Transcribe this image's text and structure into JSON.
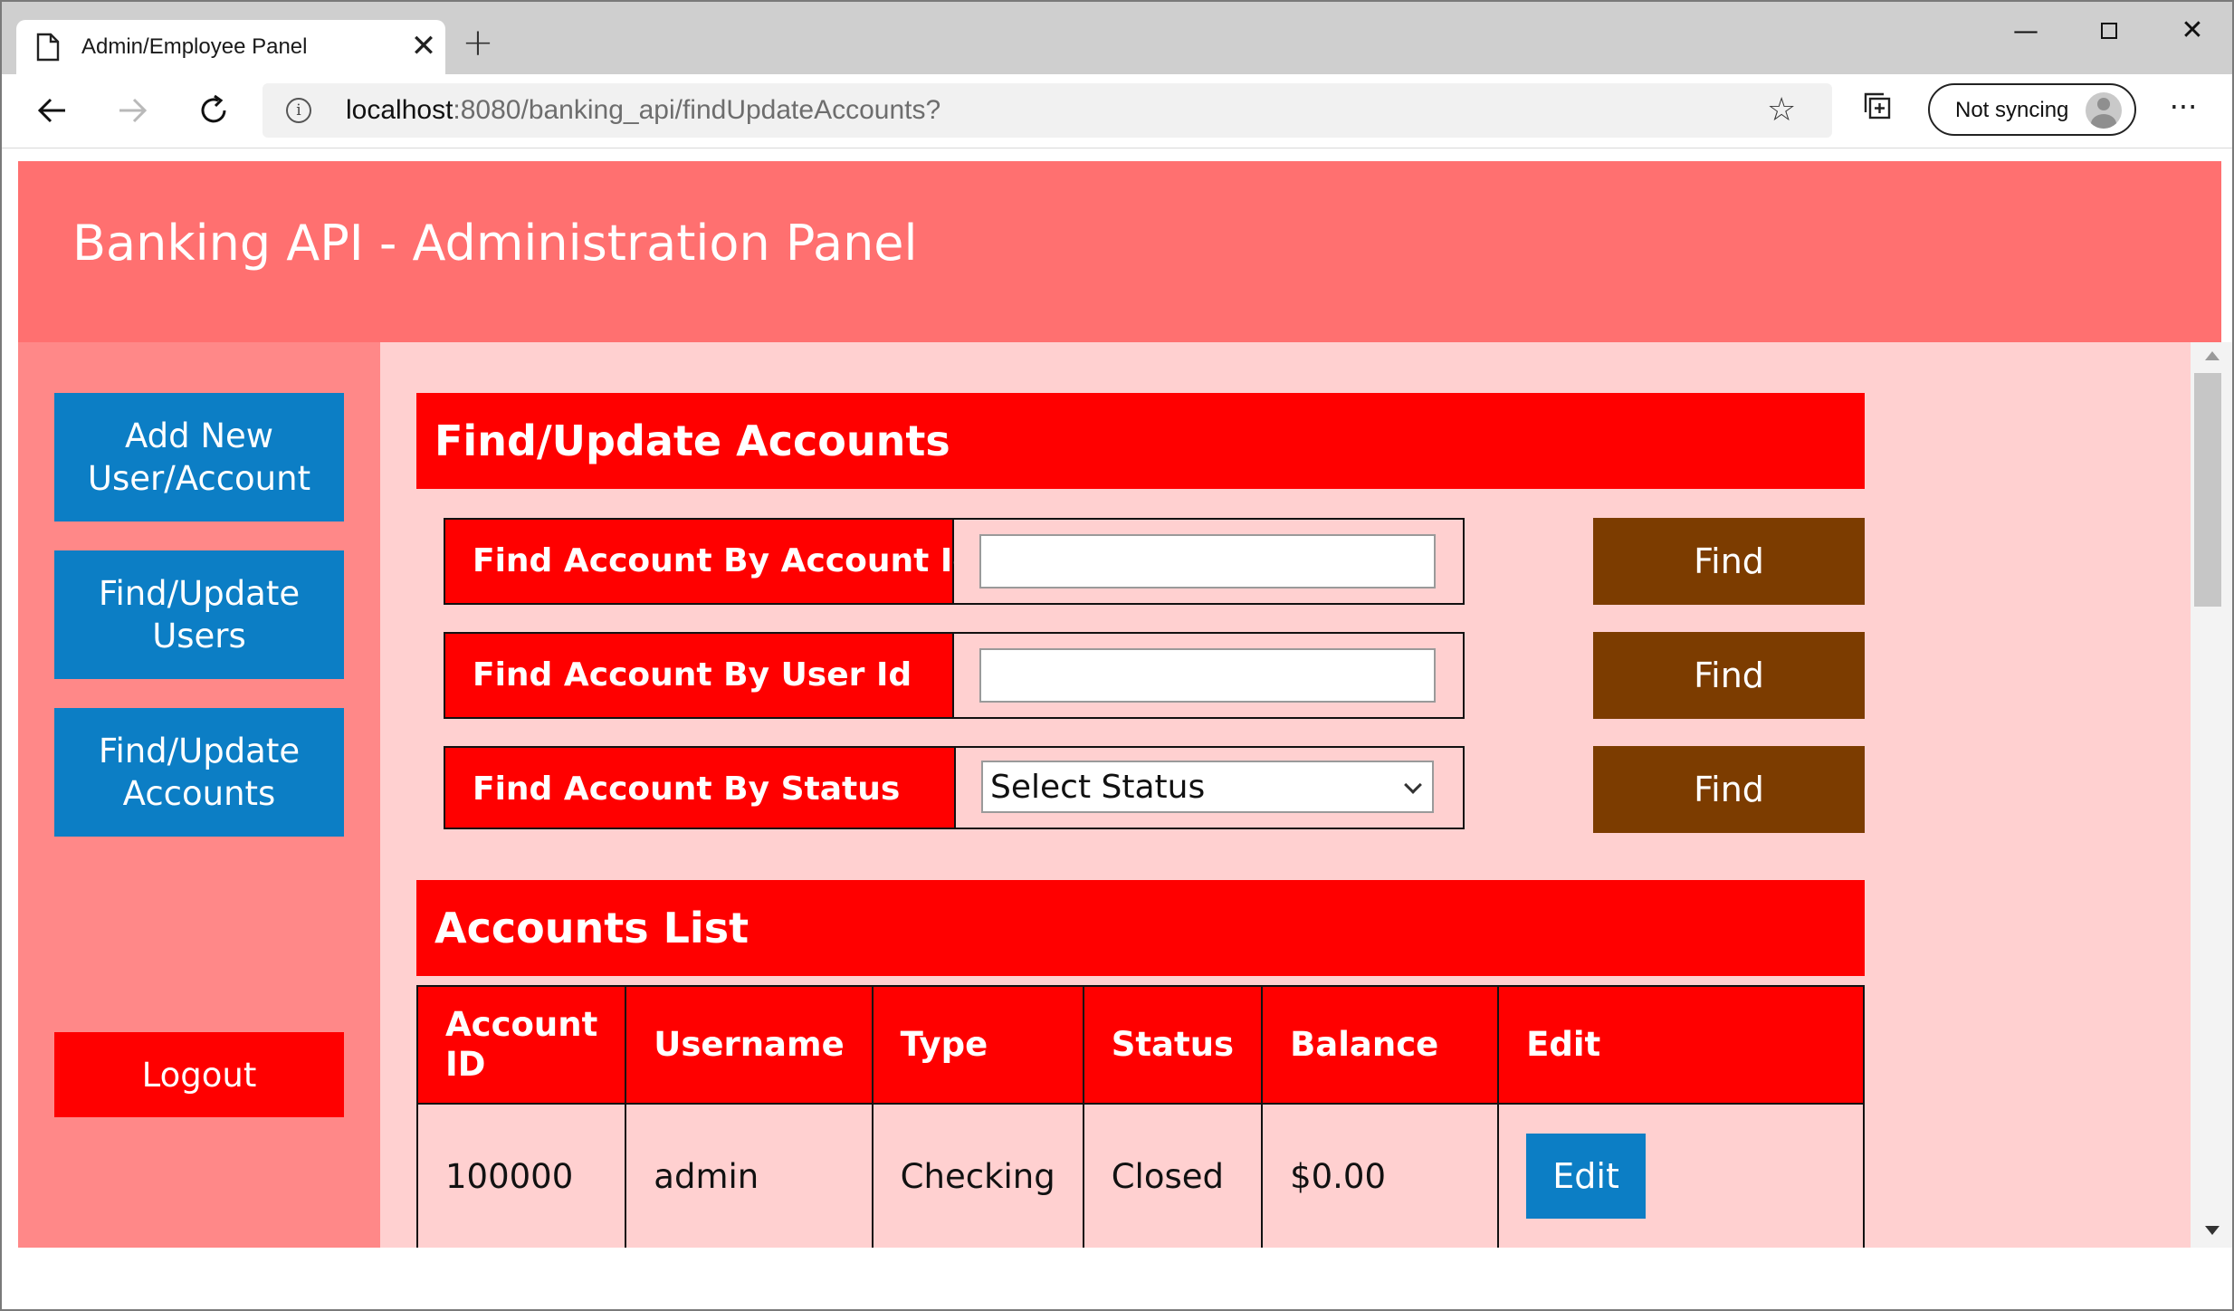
{
  "browser": {
    "tab_title": "Admin/Employee Panel",
    "tab_close": "✕",
    "new_tab": "+",
    "url_host": "localhost",
    "url_rest": ":8080/banking_api/findUpdateAccounts?",
    "sync_label": "Not syncing",
    "icons": [
      "page-icon",
      "close-icon",
      "plus-icon",
      "minimize-icon",
      "maximize-icon",
      "close-window-icon",
      "back-arrow-icon",
      "forward-arrow-icon",
      "reload-icon",
      "info-icon",
      "favorite-star-icon",
      "collections-icon",
      "profile-avatar-icon",
      "more-menu-icon"
    ]
  },
  "header": {
    "title": "Banking API - Administration Panel"
  },
  "sidebar": {
    "add_line1": "Add New",
    "add_line2": "User/Account",
    "users_line1": "Find/Update",
    "users_line2": "Users",
    "accounts_line1": "Find/Update",
    "accounts_line2": "Accounts",
    "logout": "Logout"
  },
  "find_section": {
    "title": "Find/Update Accounts",
    "by_account_id": "Find Account By Account Id",
    "by_user_id": "Find Account By User Id",
    "by_status": "Find Account By Status",
    "account_id_value": "",
    "user_id_value": "",
    "status_selected": "Select Status",
    "find_label": "Find"
  },
  "accounts_list": {
    "title": "Accounts List",
    "columns": [
      "Account ID",
      "Username",
      "Type",
      "Status",
      "Balance",
      "Edit"
    ],
    "rows": [
      {
        "account_id": "100000",
        "username": "admin",
        "type": "Checking",
        "status": "Closed",
        "balance": "$0.00",
        "edit": "Edit"
      }
    ]
  },
  "colors": {
    "header_bg": "#ff7070",
    "sidebar_bg": "#ff8888",
    "content_bg": "#ffd0d0",
    "section_red": "#ff0000",
    "nav_blue": "#0c7ec5",
    "find_brown": "#7c3c00"
  }
}
